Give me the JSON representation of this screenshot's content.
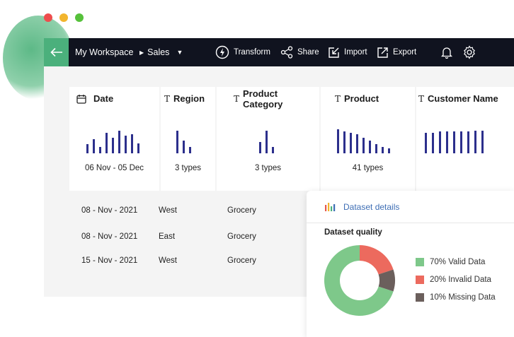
{
  "window_controls": {
    "colors": [
      "#ee4d4d",
      "#f2b52e",
      "#56c13b"
    ]
  },
  "topbar": {
    "workspace": "My Workspace",
    "dataset": "Sales",
    "actions": [
      {
        "label": "Transform",
        "icon": "lightning-icon"
      },
      {
        "label": "Share",
        "icon": "share-icon"
      },
      {
        "label": "Import",
        "icon": "import-icon"
      },
      {
        "label": "Export",
        "icon": "export-icon"
      }
    ],
    "accent_color": "#4bb07c"
  },
  "columns": [
    {
      "name": "Date",
      "type_icon": "calendar-icon",
      "summary": "06 Nov - 05 Dec",
      "bar_levels": [
        0.35,
        0.55,
        0.25,
        0.8,
        0.6,
        0.9,
        0.7,
        0.75,
        0.4
      ]
    },
    {
      "name": "Region",
      "type_icon": "text-type-icon",
      "type_glyph": "T",
      "summary": "3 types",
      "bar_levels": [
        0.9,
        0.5,
        0.25
      ]
    },
    {
      "name": "Product Category",
      "type_icon": "text-type-icon",
      "type_glyph": "T",
      "summary": "3 types",
      "bar_levels": [
        0.45,
        0.9,
        0.25
      ]
    },
    {
      "name": "Product",
      "type_icon": "text-type-icon",
      "type_glyph": "T",
      "summary": "41 types",
      "bar_levels": [
        0.95,
        0.85,
        0.8,
        0.75,
        0.6,
        0.5,
        0.35,
        0.25,
        0.2
      ]
    },
    {
      "name": "Customer Name",
      "type_icon": "text-type-icon",
      "type_glyph": "T",
      "summary": "",
      "bar_levels": [
        0.8,
        0.8,
        0.85,
        0.85,
        0.85,
        0.85,
        0.85,
        0.9,
        0.9
      ]
    }
  ],
  "rows": [
    {
      "date": "08 - Nov - 2021",
      "region": "West",
      "category": "Grocery"
    },
    {
      "date": "08 - Nov - 2021",
      "region": "East",
      "category": "Grocery"
    },
    {
      "date": "15 - Nov - 2021",
      "region": "West",
      "category": "Grocery"
    }
  ],
  "dataset_details": {
    "title": "Dataset details",
    "quality_label": "Dataset quality",
    "chart_data": {
      "type": "pie",
      "categories": [
        "Valid Data",
        "Invalid Data",
        "Missing Data"
      ],
      "values": [
        70,
        20,
        10
      ],
      "colors": [
        "#7ec88a",
        "#ec6a5e",
        "#6b5f5c"
      ]
    },
    "legend": [
      {
        "label": "70% Valid Data",
        "color": "#7ec88a"
      },
      {
        "label": "20% Invalid Data",
        "color": "#ec6a5e"
      },
      {
        "label": "10% Missing Data",
        "color": "#6b5f5c"
      }
    ]
  }
}
